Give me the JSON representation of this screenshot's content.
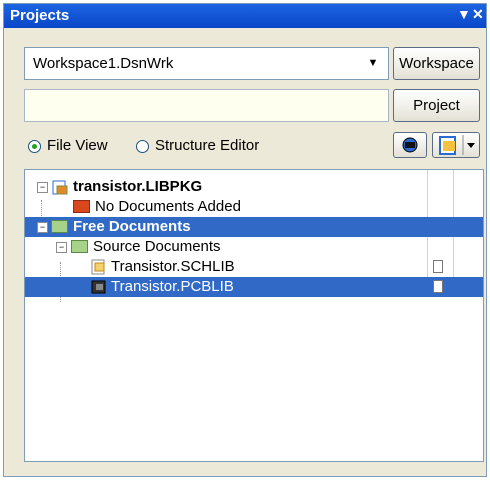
{
  "panel": {
    "title": "Projects",
    "menu_glyph": "▼",
    "close_glyph": "✕"
  },
  "workspace": {
    "selected": "Workspace1.DsnWrk",
    "button_label": "Workspace"
  },
  "project": {
    "value": "",
    "button_label": "Project"
  },
  "view_mode": {
    "options": [
      "File View",
      "Structure Editor"
    ],
    "selected": "File View"
  },
  "tree": {
    "items": [
      {
        "label": "transistor.LIBPKG",
        "bold": true,
        "selected": false,
        "icon": "library-package-icon"
      },
      {
        "label": "No Documents Added",
        "bold": false,
        "selected": false,
        "icon": "red-folder-icon"
      },
      {
        "label": "Free Documents",
        "bold": true,
        "selected": true,
        "icon": "green-folder-icon"
      },
      {
        "label": "Source Documents",
        "bold": false,
        "selected": false,
        "icon": "green-folder-icon"
      },
      {
        "label": "Transistor.SCHLIB",
        "bold": false,
        "selected": false,
        "icon": "schlib-icon"
      },
      {
        "label": "Transistor.PCBLIB",
        "bold": false,
        "selected": true,
        "icon": "pcblib-icon"
      }
    ]
  },
  "colors": {
    "titlebar": "#0a47c9",
    "selection": "#3169c6",
    "panel_bg": "#ece9d8"
  }
}
